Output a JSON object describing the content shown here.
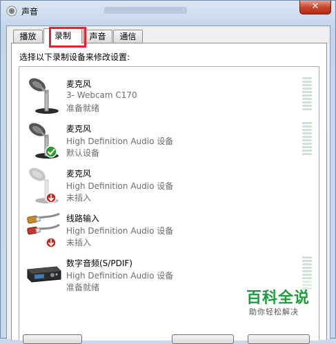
{
  "window": {
    "title": "声音",
    "close_label": "✕"
  },
  "tabs": [
    {
      "label": "播放"
    },
    {
      "label": "录制",
      "active": true
    },
    {
      "label": "声音"
    },
    {
      "label": "通信"
    }
  ],
  "instruction": "选择以下录制设备来修改设置:",
  "devices": [
    {
      "name": "麦克风",
      "description": "3- Webcam C170",
      "status": "准备就绪",
      "icon": "microphone-icon",
      "badge": "none",
      "level": 0
    },
    {
      "name": "麦克风",
      "description": "High Definition Audio 设备",
      "status": "默认设备",
      "icon": "microphone-icon",
      "badge": "default-check",
      "level": 0
    },
    {
      "name": "麦克风",
      "description": "High Definition Audio 设备",
      "status": "未插入",
      "icon": "microphone-icon",
      "badge": "unplugged",
      "level": null
    },
    {
      "name": "线路输入",
      "description": "High Definition Audio 设备",
      "status": "未插入",
      "icon": "line-in-cable-icon",
      "badge": "unplugged",
      "level": null
    },
    {
      "name": "数字音频(S/PDIF)",
      "description": "High Definition Audio 设备",
      "status": "准备就绪",
      "icon": "digital-audio-device-icon",
      "badge": "none",
      "level": 0.3
    }
  ],
  "watermark": {
    "main": "百科全说",
    "sub": "助你轻松解决"
  },
  "colors": {
    "highlight": "#e0262b",
    "meter_on": "#2a8d2f",
    "watermark": "#1c9c3a"
  }
}
